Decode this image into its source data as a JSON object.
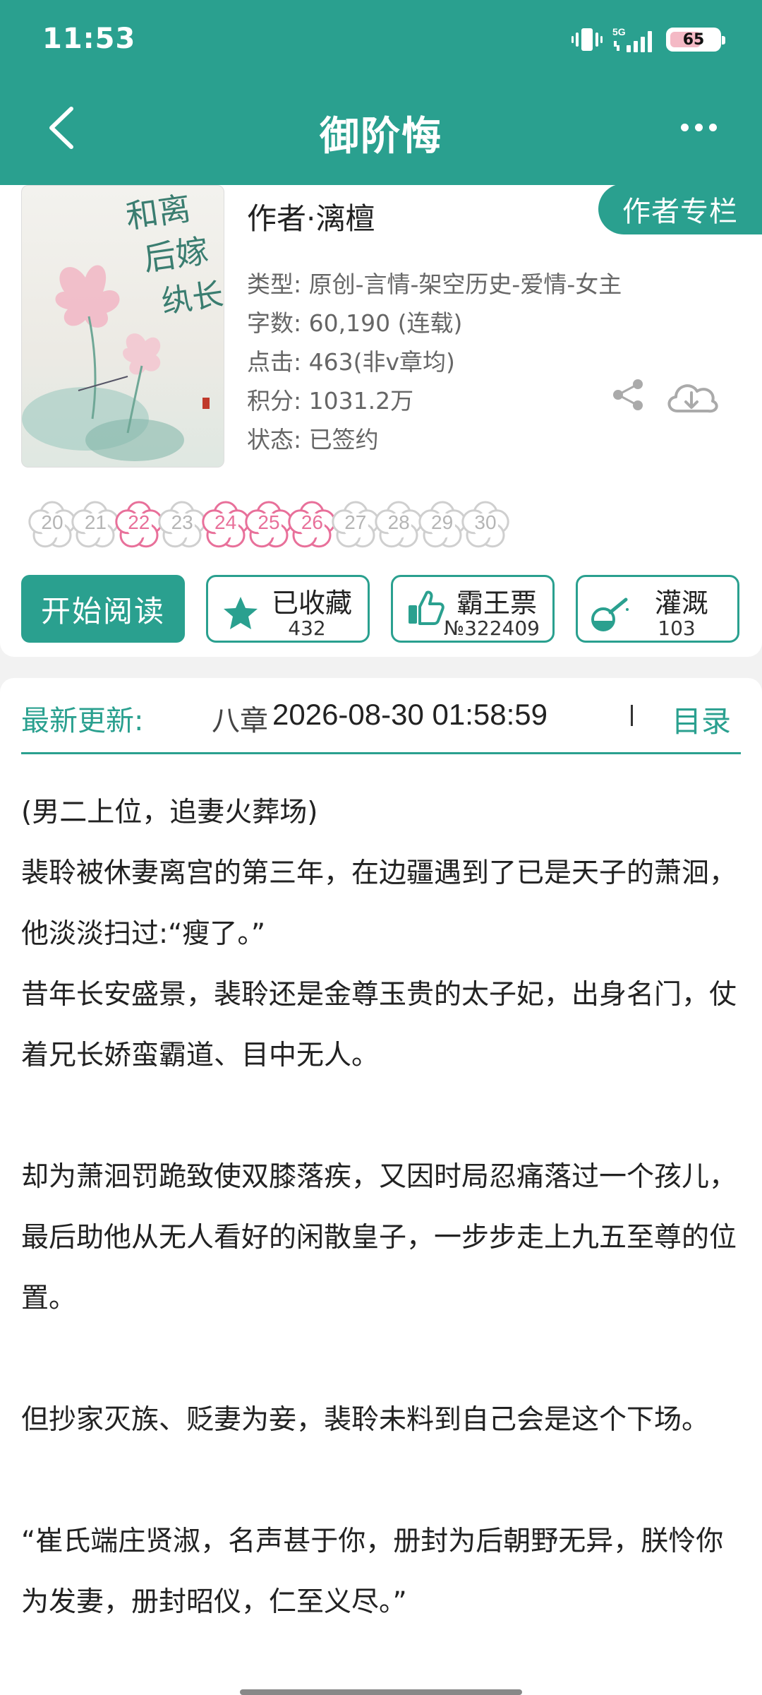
{
  "status": {
    "time": "11:53",
    "network": "5G",
    "battery": "65"
  },
  "nav": {
    "title": "御阶悔"
  },
  "book": {
    "author_tag": "作者专栏",
    "author": "作者·漓檀",
    "cover_title": "和离后嫁给纨长",
    "meta": [
      "类型: 原创-言情-架空历史-爱情-女主",
      "字数: 60,190 (连载)",
      "点击: 463(非v章均)",
      "积分: 1031.2万",
      "状态: 已签约"
    ]
  },
  "flowers": [
    {
      "num": "20",
      "active": false
    },
    {
      "num": "21",
      "active": false
    },
    {
      "num": "22",
      "active": true
    },
    {
      "num": "23",
      "active": false
    },
    {
      "num": "24",
      "active": true
    },
    {
      "num": "25",
      "active": true
    },
    {
      "num": "26",
      "active": true
    },
    {
      "num": "27",
      "active": false
    },
    {
      "num": "28",
      "active": false
    },
    {
      "num": "29",
      "active": false
    },
    {
      "num": "30",
      "active": false
    }
  ],
  "actions": {
    "read": "开始阅读",
    "favorite": {
      "label": "已收藏",
      "count": "432"
    },
    "vote": {
      "label": "霸王票",
      "count": "№322409"
    },
    "nutrient": {
      "label": "灌溉",
      "count": "103"
    }
  },
  "update": {
    "label": "最新更新:",
    "chapter": "八章",
    "time": "2026-08-30 01:58:59",
    "toc": "目录"
  },
  "synopsis": [
    "(男二上位，追妻火葬场)",
    "裴聆被休妻离宫的第三年，在边疆遇到了已是天子的萧洄，他淡淡扫过:“瘦了。”",
    "昔年长安盛景，裴聆还是金尊玉贵的太子妃，出身名门，仗着兄长娇蛮霸道、目中无人。",
    "",
    "却为萧洄罚跪致使双膝落疾，又因时局忍痛落过一个孩儿，最后助他从无人看好的闲散皇子，一步步走上九五至尊的位置。",
    "",
    "但抄家灭族、贬妻为妾，裴聆未料到自己会是这个下场。",
    "",
    "“崔氏端庄贤淑，名声甚于你，册封为后朝野无异，朕怜你为发妻，册封昭仪，仁至义尽。”"
  ],
  "colors": {
    "accent": "#2aa08f",
    "flower_active": "#e8709a",
    "flower_inactive": "#cfcfcf"
  }
}
